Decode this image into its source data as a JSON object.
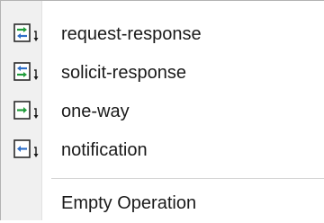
{
  "menu": {
    "items": [
      {
        "label": "request-response",
        "icon": "request-response-icon"
      },
      {
        "label": "solicit-response",
        "icon": "solicit-response-icon"
      },
      {
        "label": "one-way",
        "icon": "one-way-icon"
      },
      {
        "label": "notification",
        "icon": "notification-icon"
      }
    ],
    "empty_operation": {
      "label": "Empty Operation"
    }
  },
  "colors": {
    "icon_green": "#1f9c3a",
    "icon_blue": "#2f6fc8",
    "gutter": "#f0f0f0",
    "text": "#1a1a1a"
  }
}
